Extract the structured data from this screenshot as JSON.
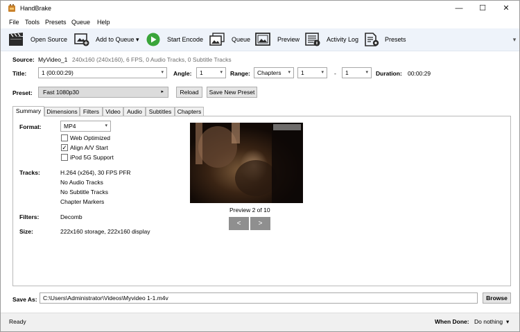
{
  "window": {
    "title": "HandBrake",
    "minimize": "—",
    "maximize": "☐",
    "close": "✕"
  },
  "menu": [
    "File",
    "Tools",
    "Presets",
    "Queue",
    "Help"
  ],
  "toolbar": {
    "open_source": "Open Source",
    "add_to_queue": "Add to Queue",
    "add_dropdown": "▾",
    "start_encode": "Start Encode",
    "queue": "Queue",
    "preview": "Preview",
    "activity_log": "Activity Log",
    "presets": "Presets",
    "overflow": "▾"
  },
  "source": {
    "label": "Source:",
    "name": "MyVideo_1",
    "info": "240x160 (240x160), 6 FPS, 0 Audio Tracks, 0 Subtitle Tracks"
  },
  "title_row": {
    "title_label": "Title:",
    "title_value": "1  (00:00:29)",
    "angle_label": "Angle:",
    "angle_value": "1",
    "range_label": "Range:",
    "range_type": "Chapters",
    "range_start": "1",
    "range_sep": "-",
    "range_end": "1",
    "duration_label": "Duration:",
    "duration_value": "00:00:29",
    "arrow": "▾"
  },
  "preset_row": {
    "label": "Preset:",
    "value": "Fast 1080p30",
    "arrow": "▸",
    "reload": "Reload",
    "save_new": "Save New Preset"
  },
  "tabs": [
    "Summary",
    "Dimensions",
    "Filters",
    "Video",
    "Audio",
    "Subtitles",
    "Chapters"
  ],
  "summary": {
    "format_label": "Format:",
    "format_value": "MP4",
    "web_optimized": "Web Optimized",
    "web_optimized_checked": false,
    "align_av": "Align A/V Start",
    "align_av_checked": true,
    "ipod": "iPod 5G Support",
    "ipod_checked": false,
    "checkmark": "✓",
    "tracks_label": "Tracks:",
    "tracks": [
      "H.264 (x264), 30 FPS PFR",
      "No Audio Tracks",
      "No Subtitle Tracks",
      "Chapter Markers"
    ],
    "filters_label": "Filters:",
    "filters_value": "Decomb",
    "size_label": "Size:",
    "size_value": "222x160 storage, 222x160 display",
    "preview_caption": "Preview 2 of 10",
    "prev": "<",
    "next": ">"
  },
  "save_as": {
    "label": "Save As:",
    "path": "C:\\Users\\Administrator\\Videos\\Myvideo 1-1.m4v",
    "browse": "Browse"
  },
  "status": {
    "text": "Ready",
    "when_done_label": "When Done:",
    "when_done_value": "Do nothing",
    "arrow": "▾"
  }
}
